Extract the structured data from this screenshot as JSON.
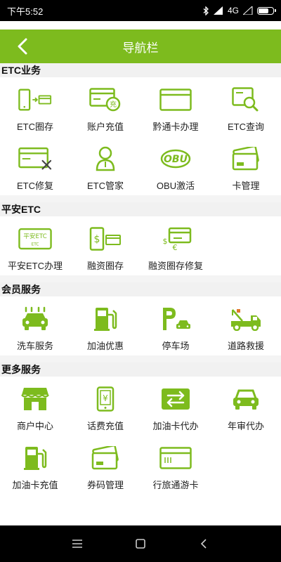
{
  "status_bar": {
    "time": "下午5:52",
    "network": "4G"
  },
  "header": {
    "title": "导航栏"
  },
  "colors": {
    "accent": "#7dbb1e",
    "section_bg": "#f1f1f1"
  },
  "sections": [
    {
      "title": "ETC业务",
      "items": [
        {
          "label": "ETC圈存",
          "icon": "phone-card-transfer-icon"
        },
        {
          "label": "账户充值",
          "icon": "card-recharge-icon"
        },
        {
          "label": "黔通卡办理",
          "icon": "card-icon"
        },
        {
          "label": "ETC查询",
          "icon": "card-search-icon"
        },
        {
          "label": "ETC修复",
          "icon": "card-repair-icon"
        },
        {
          "label": "ETC管家",
          "icon": "person-icon"
        },
        {
          "label": "OBU激活",
          "icon": "obu-icon"
        },
        {
          "label": "卡管理",
          "icon": "cards-stack-icon"
        }
      ]
    },
    {
      "title": "平安ETC",
      "items": [
        {
          "label": "平安ETC办理",
          "icon": "pingan-etc-card-icon",
          "card_top": "平安ETC",
          "card_bottom": "ETC"
        },
        {
          "label": "融资圈存",
          "icon": "phone-money-icon"
        },
        {
          "label": "融资圈存修复",
          "icon": "currency-card-icon"
        }
      ]
    },
    {
      "title": "会员服务",
      "items": [
        {
          "label": "洗车服务",
          "icon": "car-wash-icon"
        },
        {
          "label": "加油优惠",
          "icon": "fuel-pump-icon"
        },
        {
          "label": "停车场",
          "icon": "parking-icon"
        },
        {
          "label": "道路救援",
          "icon": "tow-truck-icon"
        }
      ]
    },
    {
      "title": "更多服务",
      "items": [
        {
          "label": "商户中心",
          "icon": "store-icon"
        },
        {
          "label": "话费充值",
          "icon": "phone-yuan-icon"
        },
        {
          "label": "加油卡代办",
          "icon": "exchange-card-icon"
        },
        {
          "label": "年审代办",
          "icon": "car-icon"
        },
        {
          "label": "加油卡充值",
          "icon": "fuel-pump-icon"
        },
        {
          "label": "券码管理",
          "icon": "coupon-cards-icon"
        },
        {
          "label": "行旅通游卡",
          "icon": "travel-card-icon"
        }
      ]
    }
  ]
}
